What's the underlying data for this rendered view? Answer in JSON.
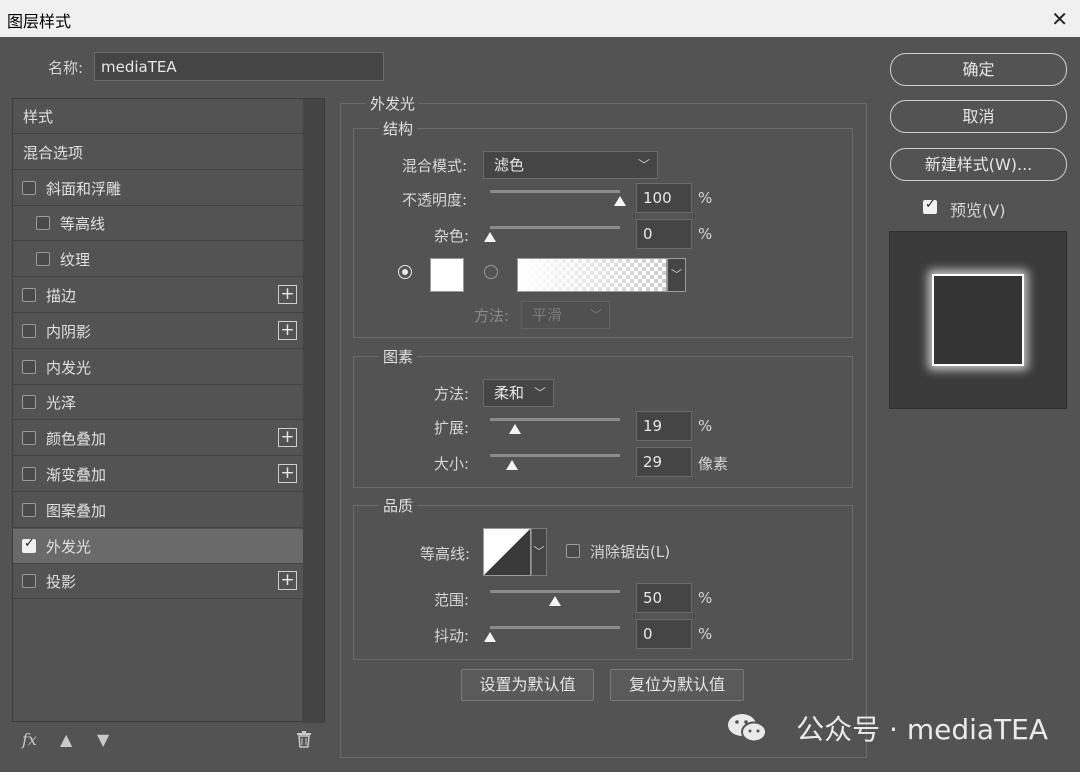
{
  "window": {
    "title": "图层样式",
    "close_icon": "close-icon"
  },
  "name_field": {
    "label": "名称:",
    "value": "mediaTEA"
  },
  "style_list": {
    "items": [
      {
        "label": "样式",
        "checkbox": false,
        "checked": false,
        "plus": false,
        "selected": false,
        "indent": 0
      },
      {
        "label": "混合选项",
        "checkbox": false,
        "checked": false,
        "plus": false,
        "selected": false,
        "indent": 0
      },
      {
        "label": "斜面和浮雕",
        "checkbox": true,
        "checked": false,
        "plus": false,
        "selected": false,
        "indent": 0
      },
      {
        "label": "等高线",
        "checkbox": true,
        "checked": false,
        "plus": false,
        "selected": false,
        "indent": 1
      },
      {
        "label": "纹理",
        "checkbox": true,
        "checked": false,
        "plus": false,
        "selected": false,
        "indent": 1
      },
      {
        "label": "描边",
        "checkbox": true,
        "checked": false,
        "plus": true,
        "selected": false,
        "indent": 0
      },
      {
        "label": "内阴影",
        "checkbox": true,
        "checked": false,
        "plus": true,
        "selected": false,
        "indent": 0
      },
      {
        "label": "内发光",
        "checkbox": true,
        "checked": false,
        "plus": false,
        "selected": false,
        "indent": 0
      },
      {
        "label": "光泽",
        "checkbox": true,
        "checked": false,
        "plus": false,
        "selected": false,
        "indent": 0
      },
      {
        "label": "颜色叠加",
        "checkbox": true,
        "checked": false,
        "plus": true,
        "selected": false,
        "indent": 0
      },
      {
        "label": "渐变叠加",
        "checkbox": true,
        "checked": false,
        "plus": true,
        "selected": false,
        "indent": 0
      },
      {
        "label": "图案叠加",
        "checkbox": true,
        "checked": false,
        "plus": false,
        "selected": false,
        "indent": 0
      },
      {
        "label": "外发光",
        "checkbox": true,
        "checked": true,
        "plus": false,
        "selected": true,
        "indent": 0
      },
      {
        "label": "投影",
        "checkbox": true,
        "checked": false,
        "plus": true,
        "selected": false,
        "indent": 0
      }
    ],
    "bottom": {
      "fx": "fx",
      "up_icon": "arrow-up-icon",
      "down_icon": "arrow-down-icon",
      "trash_icon": "trash-icon"
    }
  },
  "panel": {
    "title": "外发光",
    "structure": {
      "title": "结构",
      "blend_mode": {
        "label": "混合模式:",
        "value": "滤色"
      },
      "opacity": {
        "label": "不透明度:",
        "value": "100",
        "unit": "%",
        "fraction": 1.0
      },
      "noise": {
        "label": "杂色:",
        "value": "0",
        "unit": "%",
        "fraction": 0.0
      },
      "color_swatch": "#ffffff",
      "method": {
        "label": "方法:",
        "value": "平滑"
      }
    },
    "elements": {
      "title": "图素",
      "technique": {
        "label": "方法:",
        "value": "柔和"
      },
      "spread": {
        "label": "扩展:",
        "value": "19",
        "unit": "%",
        "fraction": 0.19
      },
      "size": {
        "label": "大小:",
        "value": "29",
        "unit": "像素",
        "fraction": 0.17
      }
    },
    "quality": {
      "title": "品质",
      "contour": {
        "label": "等高线:"
      },
      "anti_alias": {
        "label": "消除锯齿(L)",
        "checked": false
      },
      "range": {
        "label": "范围:",
        "value": "50",
        "unit": "%",
        "fraction": 0.5
      },
      "jitter": {
        "label": "抖动:",
        "value": "0",
        "unit": "%",
        "fraction": 0.0
      }
    },
    "buttons": {
      "set_default": "设置为默认值",
      "reset_default": "复位为默认值"
    }
  },
  "right": {
    "ok": "确定",
    "cancel": "取消",
    "new_style": "新建样式(W)...",
    "preview": {
      "label": "预览(V)",
      "checked": true
    }
  },
  "watermark": {
    "text": "公众号 · mediaTEA",
    "icon": "wechat-icon"
  }
}
